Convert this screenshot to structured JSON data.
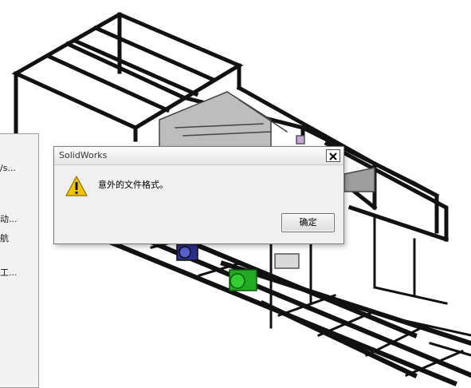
{
  "side_panel": {
    "items": [
      "/s...",
      "动...",
      "航",
      "工..."
    ]
  },
  "dialog": {
    "title": "SolidWorks",
    "close_symbol": "✕",
    "message": "意外的文件格式。",
    "ok_label": "确定",
    "icon": "warning-icon"
  },
  "viewport": {
    "model_icon_colors": {
      "motor_green": "#22aa22",
      "motor_blue": "#2a2f8a"
    }
  }
}
